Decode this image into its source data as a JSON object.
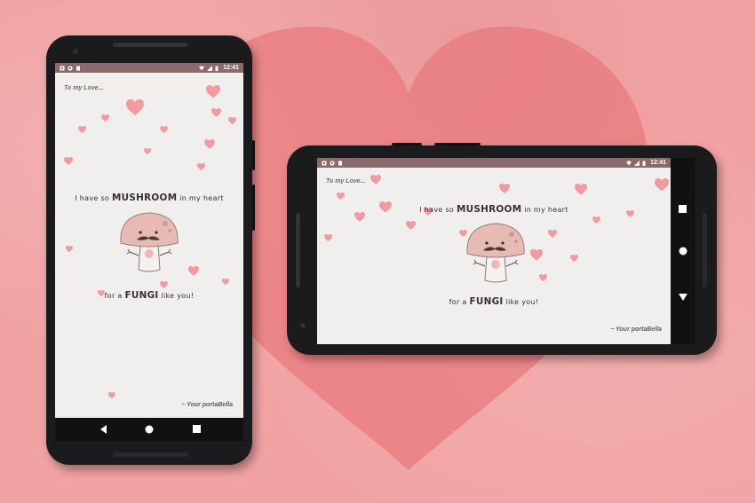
{
  "colors": {
    "background": "#f1a2a3",
    "big_heart": "#e8787a",
    "status_bar": "#8a6b6a",
    "heart_pink": "#f29b9e",
    "screen_bg": "#f1efee",
    "text_dark": "#3a3030"
  },
  "status_bar": {
    "time": "12:41",
    "left_icons": [
      "notification-app-icon",
      "notification-circle-icon",
      "notification-sdcard-icon"
    ],
    "right_icons": [
      "wifi-icon",
      "signal-icon",
      "battery-icon"
    ]
  },
  "card": {
    "greeting": "To my Love...",
    "line1_start": "I have so",
    "line1_emph": "MUSHROOM",
    "line1_end": "in my heart",
    "line2_start": "for a",
    "line2_emph": "FUNGI",
    "line2_end": "like you!",
    "signature": "~ Your portaBella"
  },
  "nav_bar": {
    "buttons": [
      "back-icon",
      "home-icon",
      "recents-icon"
    ]
  }
}
